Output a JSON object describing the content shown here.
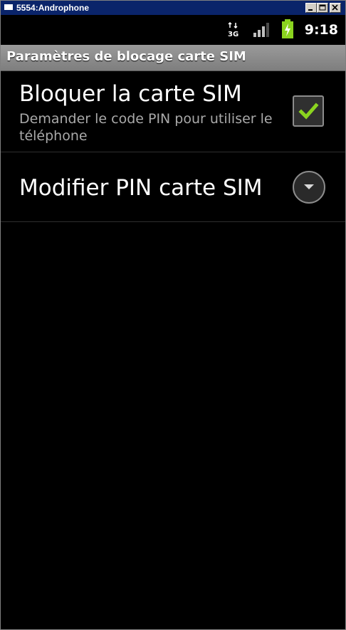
{
  "window": {
    "title": "5554:Androphone"
  },
  "status_bar": {
    "clock": "9:18",
    "network_type_icon": "3g-data-icon",
    "signal_icon": "signal-strength-icon",
    "battery_icon": "battery-charging-icon",
    "battery_color": "#8bd41f"
  },
  "app_bar": {
    "title": "Paramètres de blocage carte SIM"
  },
  "preferences": [
    {
      "title": "Bloquer la carte SIM",
      "summary": "Demander le code PIN pour utiliser le téléphone",
      "control": "checkbox",
      "checked": true,
      "check_color": "#8bd41f"
    },
    {
      "title": "Modifier PIN carte SIM",
      "control": "dropdown-arrow"
    }
  ]
}
